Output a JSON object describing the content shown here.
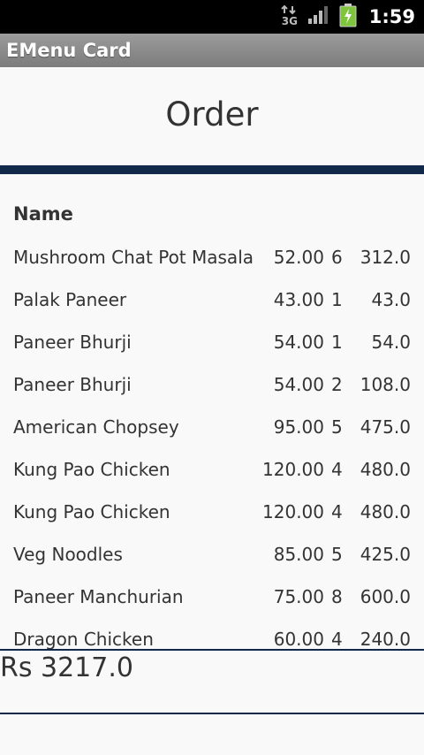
{
  "status_bar": {
    "network_label": "3G",
    "time": "1:59",
    "icons": [
      "data-3g-icon",
      "signal-icon",
      "battery-charging-icon"
    ]
  },
  "app": {
    "title": "EMenu Card"
  },
  "page": {
    "title": "Order"
  },
  "table": {
    "header_name": "Name",
    "rows": [
      {
        "name": "Mushroom Chat Pot Masala",
        "price": "52.00",
        "qty": "6",
        "total": "312.0"
      },
      {
        "name": "Palak Paneer",
        "price": "43.00",
        "qty": "1",
        "total": "43.0"
      },
      {
        "name": "Paneer Bhurji",
        "price": "54.00",
        "qty": "1",
        "total": "54.0"
      },
      {
        "name": "Paneer Bhurji",
        "price": "54.00",
        "qty": "2",
        "total": "108.0"
      },
      {
        "name": "American Chopsey",
        "price": "95.00",
        "qty": "5",
        "total": "475.0"
      },
      {
        "name": "Kung Pao Chicken",
        "price": "120.00",
        "qty": "4",
        "total": "480.0"
      },
      {
        "name": "Kung Pao Chicken",
        "price": "120.00",
        "qty": "4",
        "total": "480.0"
      },
      {
        "name": "Veg Noodles",
        "price": "85.00",
        "qty": "5",
        "total": "425.0"
      },
      {
        "name": "Paneer Manchurian",
        "price": "75.00",
        "qty": "8",
        "total": "600.0"
      },
      {
        "name": "Dragon Chicken",
        "price": "60.00",
        "qty": "4",
        "total": "240.0"
      }
    ]
  },
  "summary": {
    "total": "Rs 3217.0"
  },
  "colors": {
    "divider": "#112849",
    "status_bar": "#000000",
    "title_bar": "#8a8a8a",
    "battery": "#7ec43c"
  }
}
